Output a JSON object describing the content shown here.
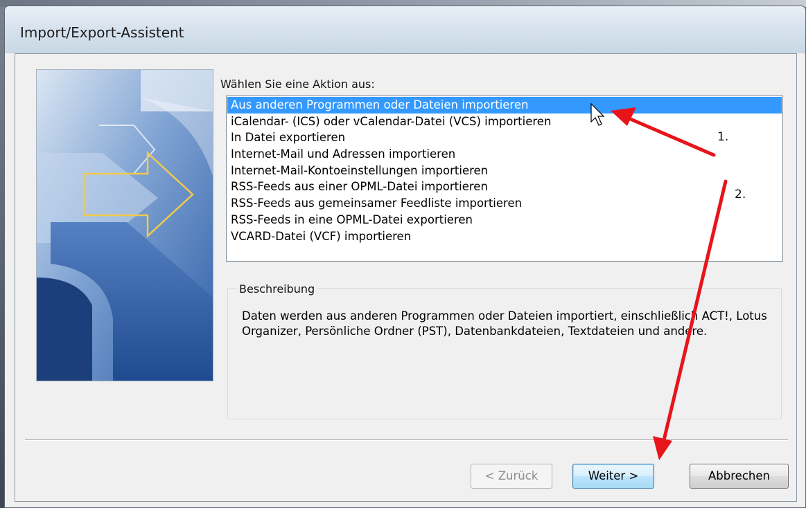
{
  "window": {
    "title": "Import/Export-Assistent"
  },
  "prompt_label": "Wählen Sie eine Aktion aus:",
  "actions": [
    "Aus anderen Programmen oder Dateien importieren",
    "iCalendar- (ICS) oder vCalendar-Datei (VCS) importieren",
    "In Datei exportieren",
    "Internet-Mail und Adressen importieren",
    "Internet-Mail-Kontoeinstellungen importieren",
    "RSS-Feeds aus einer OPML-Datei importieren",
    "RSS-Feeds aus gemeinsamer Feedliste importieren",
    "RSS-Feeds in eine OPML-Datei exportieren",
    "VCARD-Datei (VCF) importieren"
  ],
  "selected_index": 0,
  "description": {
    "title": "Beschreibung",
    "text": "Daten werden aus anderen Programmen oder Dateien importiert, einschließlich ACT!, Lotus Organizer, Persönliche Ordner (PST), Datenbankdateien, Textdateien und andere."
  },
  "buttons": {
    "back": "< Zurück",
    "next": "Weiter >",
    "cancel": "Abbrechen"
  },
  "annotations": {
    "label_1": "1.",
    "label_2": "2.",
    "arrow_color": "#e8141b"
  },
  "colors": {
    "selection": "#3399ff",
    "wizard_blue": "#2d5ea6"
  }
}
